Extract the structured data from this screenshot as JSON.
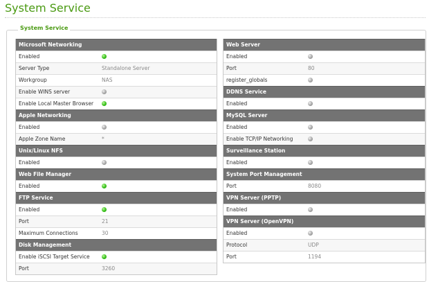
{
  "page": {
    "title": "System Service",
    "legend": "System Service"
  },
  "colors": {
    "accent": "#4a9a12",
    "header_bg": "#737373",
    "status_on": "#38c21a",
    "status_off": "#a8a8a8"
  },
  "left": [
    {
      "header": "Microsoft Networking",
      "rows": [
        {
          "label": "Enabled",
          "status": "on"
        },
        {
          "label": "Server Type",
          "value": "Standalone Server"
        },
        {
          "label": "Workgroup",
          "value": "NAS"
        },
        {
          "label": "Enable WINS server",
          "status": "off"
        },
        {
          "label": "Enable Local Master Browser",
          "status": "on"
        }
      ]
    },
    {
      "header": "Apple Networking",
      "rows": [
        {
          "label": "Enabled",
          "status": "off"
        },
        {
          "label": "Apple Zone Name",
          "value": "*"
        }
      ]
    },
    {
      "header": "Unix/Linux NFS",
      "rows": [
        {
          "label": "Enabled",
          "status": "off"
        }
      ]
    },
    {
      "header": "Web File Manager",
      "rows": [
        {
          "label": "Enabled",
          "status": "on"
        }
      ]
    },
    {
      "header": "FTP Service",
      "rows": [
        {
          "label": "Enabled",
          "status": "on"
        },
        {
          "label": "Port",
          "value": "21"
        },
        {
          "label": "Maximum Connections",
          "value": "30"
        }
      ]
    },
    {
      "header": "Disk Management",
      "rows": [
        {
          "label": "Enable iSCSI Target Service",
          "status": "on"
        },
        {
          "label": "Port",
          "value": "3260"
        }
      ]
    }
  ],
  "right": [
    {
      "header": "Web Server",
      "rows": [
        {
          "label": "Enabled",
          "status": "off"
        },
        {
          "label": "Port",
          "value": "80"
        },
        {
          "label": "register_globals",
          "status": "off"
        }
      ]
    },
    {
      "header": "DDNS Service",
      "rows": [
        {
          "label": "Enabled",
          "status": "off"
        }
      ]
    },
    {
      "header": "MySQL Server",
      "rows": [
        {
          "label": "Enabled",
          "status": "off"
        },
        {
          "label": "Enable TCP/IP Networking",
          "status": "off"
        }
      ]
    },
    {
      "header": "Surveillance Station",
      "rows": [
        {
          "label": "Enabled",
          "status": "off"
        }
      ]
    },
    {
      "header": "System Port Management",
      "rows": [
        {
          "label": "Port",
          "value": "8080"
        }
      ]
    },
    {
      "header": "VPN Server (PPTP)",
      "rows": [
        {
          "label": "Enabled",
          "status": "off"
        }
      ]
    },
    {
      "header": "VPN Server (OpenVPN)",
      "rows": [
        {
          "label": "Enabled",
          "status": "off"
        },
        {
          "label": "Protocol",
          "value": "UDP"
        },
        {
          "label": "Port",
          "value": "1194"
        }
      ]
    }
  ]
}
